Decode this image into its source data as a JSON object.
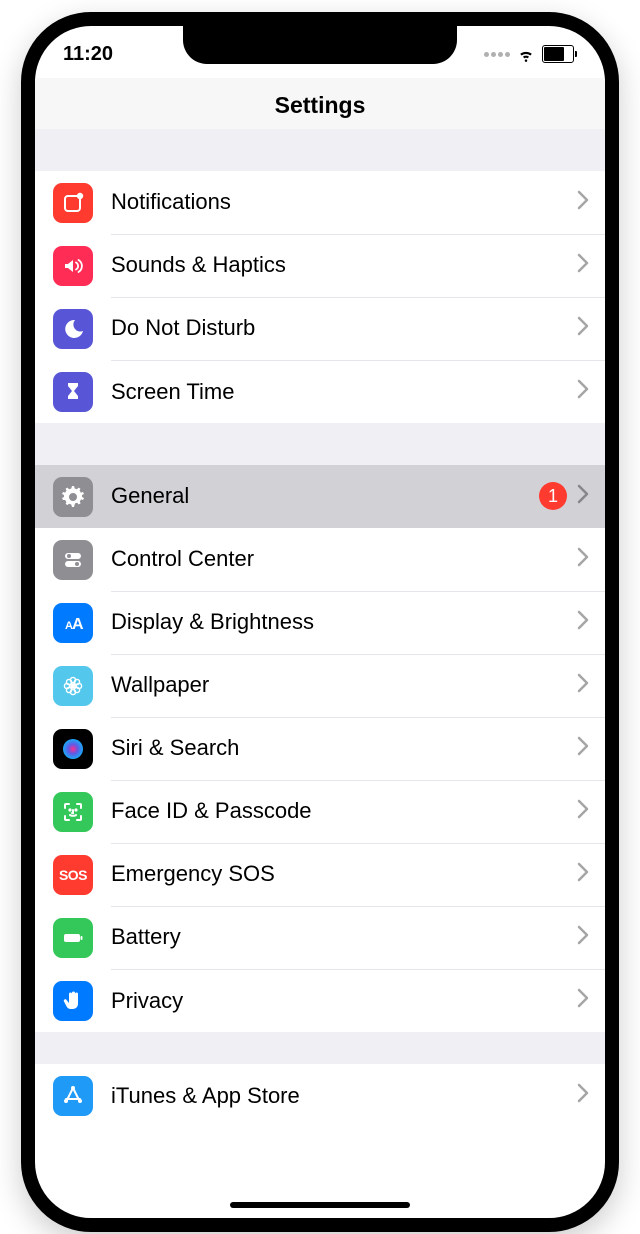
{
  "status": {
    "time": "11:20"
  },
  "title": "Settings",
  "groups": [
    {
      "items": [
        {
          "id": "notifications",
          "label": "Notifications",
          "icon": "notification-badge-icon",
          "color": "#ff3b30"
        },
        {
          "id": "sounds",
          "label": "Sounds & Haptics",
          "icon": "speaker-icon",
          "color": "#ff2d55"
        },
        {
          "id": "dnd",
          "label": "Do Not Disturb",
          "icon": "moon-icon",
          "color": "#5856d6"
        },
        {
          "id": "screentime",
          "label": "Screen Time",
          "icon": "hourglass-icon",
          "color": "#5856d6"
        }
      ]
    },
    {
      "items": [
        {
          "id": "general",
          "label": "General",
          "icon": "gear-icon",
          "color": "#8e8e93",
          "badge": "1",
          "selected": true
        },
        {
          "id": "controlcenter",
          "label": "Control Center",
          "icon": "toggles-icon",
          "color": "#8e8e93"
        },
        {
          "id": "display",
          "label": "Display & Brightness",
          "icon": "text-size-icon",
          "color": "#007aff"
        },
        {
          "id": "wallpaper",
          "label": "Wallpaper",
          "icon": "flower-icon",
          "color": "#54c7ec"
        },
        {
          "id": "siri",
          "label": "Siri & Search",
          "icon": "siri-icon",
          "color": "#000000"
        },
        {
          "id": "faceid",
          "label": "Face ID & Passcode",
          "icon": "face-id-icon",
          "color": "#34c759"
        },
        {
          "id": "sos",
          "label": "Emergency SOS",
          "icon": "sos-icon",
          "color": "#ff3b30"
        },
        {
          "id": "battery",
          "label": "Battery",
          "icon": "battery-icon",
          "color": "#34c759"
        },
        {
          "id": "privacy",
          "label": "Privacy",
          "icon": "hand-icon",
          "color": "#007aff"
        }
      ]
    },
    {
      "items": [
        {
          "id": "appstore",
          "label": "iTunes & App Store",
          "icon": "appstore-icon",
          "color": "#1f9af7"
        }
      ]
    }
  ]
}
